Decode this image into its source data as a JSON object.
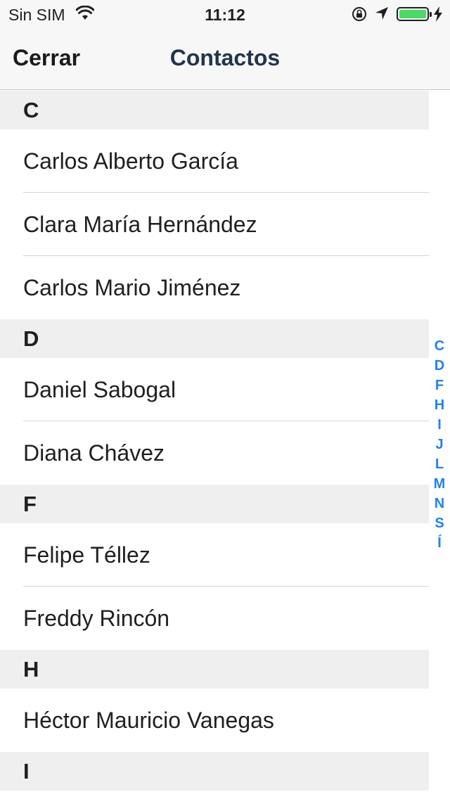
{
  "status_bar": {
    "carrier": "Sin SIM",
    "time": "11:12",
    "battery_color": "#4cd964"
  },
  "nav": {
    "left_button": "Cerrar",
    "title": "Contactos"
  },
  "sections": [
    {
      "letter": "C",
      "contacts": [
        "Carlos Alberto García",
        "Clara María Hernández",
        "Carlos Mario Jiménez"
      ]
    },
    {
      "letter": "D",
      "contacts": [
        "Daniel Sabogal",
        "Diana Chávez"
      ]
    },
    {
      "letter": "F",
      "contacts": [
        "Felipe Téllez",
        "Freddy Rincón"
      ]
    },
    {
      "letter": "H",
      "contacts": [
        "Héctor Mauricio Vanegas"
      ]
    },
    {
      "letter": "I",
      "contacts": []
    }
  ],
  "index_letters": [
    "C",
    "D",
    "F",
    "H",
    "I",
    "J",
    "L",
    "M",
    "N",
    "S",
    "Í"
  ],
  "accent_color": "#1e82f0"
}
